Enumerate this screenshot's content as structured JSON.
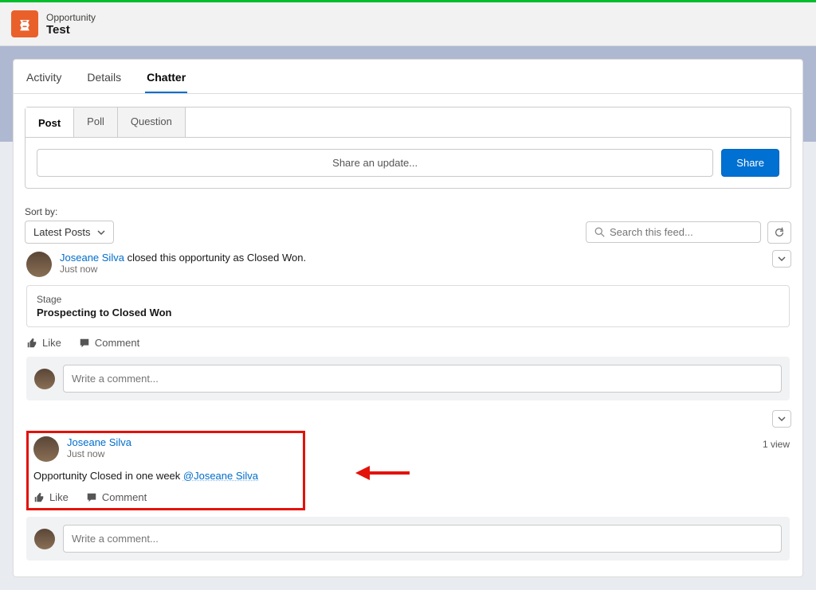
{
  "record": {
    "type_label": "Opportunity",
    "name": "Test"
  },
  "tabs": {
    "activity": "Activity",
    "details": "Details",
    "chatter": "Chatter"
  },
  "publisher": {
    "tabs": {
      "post": "Post",
      "poll": "Poll",
      "question": "Question"
    },
    "placeholder": "Share an update...",
    "share_btn": "Share"
  },
  "sort": {
    "label": "Sort by:",
    "selected": "Latest Posts",
    "search_placeholder": "Search this feed..."
  },
  "post1": {
    "author": "Joseane Silva",
    "action_text": " closed this opportunity as Closed Won.",
    "time": "Just now",
    "change_field": "Stage",
    "change_value": "Prospecting to Closed Won",
    "like": "Like",
    "comment": "Comment",
    "comment_placeholder": "Write a comment..."
  },
  "post2": {
    "author": "Joseane Silva",
    "time": "Just now",
    "body_prefix": "Opportunity Closed in one week ",
    "mention": "@Joseane Silva",
    "like": "Like",
    "comment": "Comment",
    "views": "1 view",
    "comment_placeholder": "Write a comment..."
  }
}
